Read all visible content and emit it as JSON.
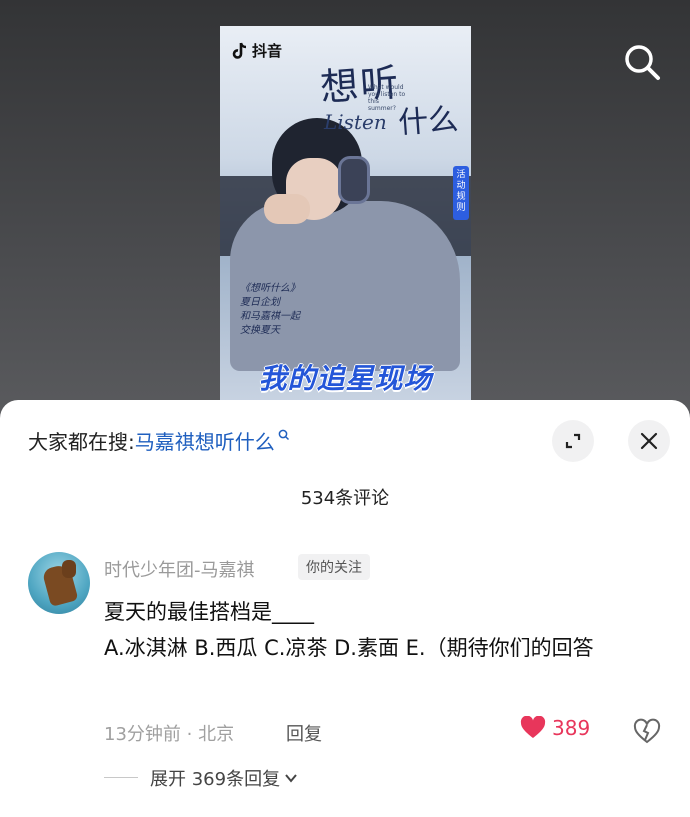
{
  "poster": {
    "logo_text": "抖音",
    "title_line1": "想听",
    "title_line2": "什么",
    "listen_word": "Listen",
    "subtitle": "What would you listen to this summer?",
    "rules_label": "活动规则",
    "handwriting": [
      "《想听什么》",
      "夏日企划",
      "和马嘉祺一起",
      "交换夏天"
    ],
    "banner": "我的追星现场"
  },
  "search_icon": "search-icon",
  "trending": {
    "prefix": "大家都在搜: ",
    "keyword": "马嘉祺想听什么"
  },
  "comments_count": "534条评论",
  "comment": {
    "username": "时代少年团-马嘉祺",
    "follow_tag": "你的关注",
    "text": "夏天的最佳搭档是____\nA.冰淇淋 B.西瓜 C.凉茶 D.素面 E.（期待你们的回答",
    "meta": "13分钟前 · 北京",
    "reply_label": "回复",
    "likes": "389",
    "like_color": "#e8365b",
    "expand_label": "展开 369条回复"
  }
}
